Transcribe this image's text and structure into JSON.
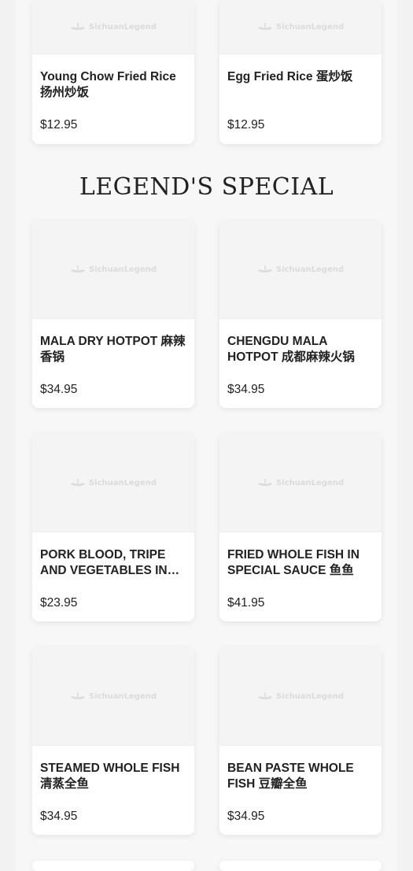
{
  "top_items": [
    {
      "name": "Young Chow Fried Rice 扬州炒饭",
      "price": "$12.95"
    },
    {
      "name": "Egg Fried Rice 蛋炒饭",
      "price": "$12.95"
    }
  ],
  "section": {
    "title": "LEGEND'S SPECIAL"
  },
  "special_items": [
    {
      "name": "MALA DRY HOTPOT 麻辣香锅",
      "price": "$34.95"
    },
    {
      "name": "CHENGDU MALA HOTPOT 成都麻辣火锅",
      "price": "$34.95"
    },
    {
      "name": "PORK BLOOD, TRIPE AND VEGETABLES IN…",
      "price": "$23.95"
    },
    {
      "name": "FRIED WHOLE FISH IN SPECIAL SAUCE 鱼鱼",
      "price": "$41.95"
    },
    {
      "name": "STEAMED WHOLE FISH 清蒸全鱼",
      "price": "$34.95"
    },
    {
      "name": "BEAN PASTE WHOLE FISH 豆瓣全鱼",
      "price": "$34.95"
    }
  ],
  "logo_text": "SichuanLegend",
  "icons": {
    "placeholder": "sichuan-legend-logo-icon"
  }
}
